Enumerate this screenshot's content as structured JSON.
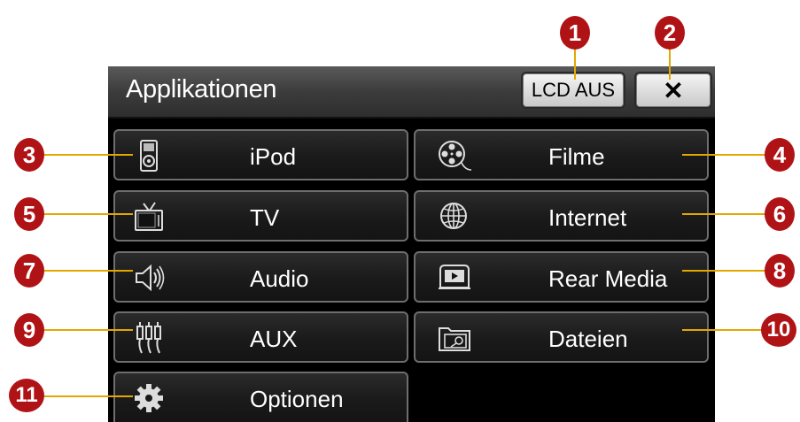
{
  "header": {
    "title": "Applikationen",
    "lcd_label": "LCD AUS",
    "close_label": "✕"
  },
  "apps": {
    "ipod": "iPod",
    "filme": "Filme",
    "tv": "TV",
    "internet": "Internet",
    "audio": "Audio",
    "rear_media": "Rear Media",
    "aux": "AUX",
    "dateien": "Dateien",
    "optionen": "Optionen"
  },
  "callouts": [
    "1",
    "2",
    "3",
    "4",
    "5",
    "6",
    "7",
    "8",
    "9",
    "10",
    "11"
  ],
  "colors": {
    "badge": "#b01316",
    "callout_line": "#e3a800",
    "screen_bg": "#000000"
  }
}
